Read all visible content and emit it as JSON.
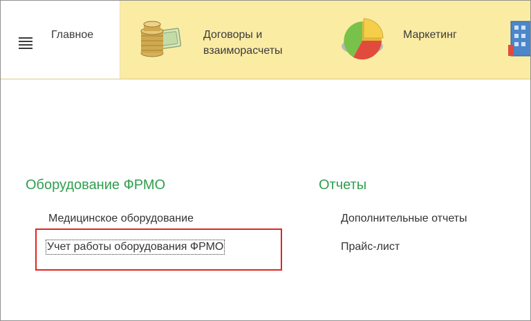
{
  "sections": {
    "tabs": [
      {
        "label": "Главное",
        "icon": "hamburger-menu-icon"
      },
      {
        "label": "Договоры и\nвзаиморасчеты",
        "icon": "coins-money-icon"
      },
      {
        "label": "Маркетинг",
        "icon": "pie-chart-icon"
      },
      {
        "label": "",
        "icon": "building-icon"
      }
    ],
    "active": "Главное"
  },
  "groups": [
    {
      "title": "Оборудование ФРМО",
      "items": [
        "Медицинское оборудование",
        "Учет работы оборудования ФРМО"
      ]
    },
    {
      "title": "Отчеты",
      "items": [
        "Дополнительные отчеты",
        "Прайс-лист"
      ]
    }
  ],
  "colors": {
    "section_bar": "#fbeca4",
    "group_title": "#2f9e4e",
    "annotation_box": "#e3241f"
  }
}
